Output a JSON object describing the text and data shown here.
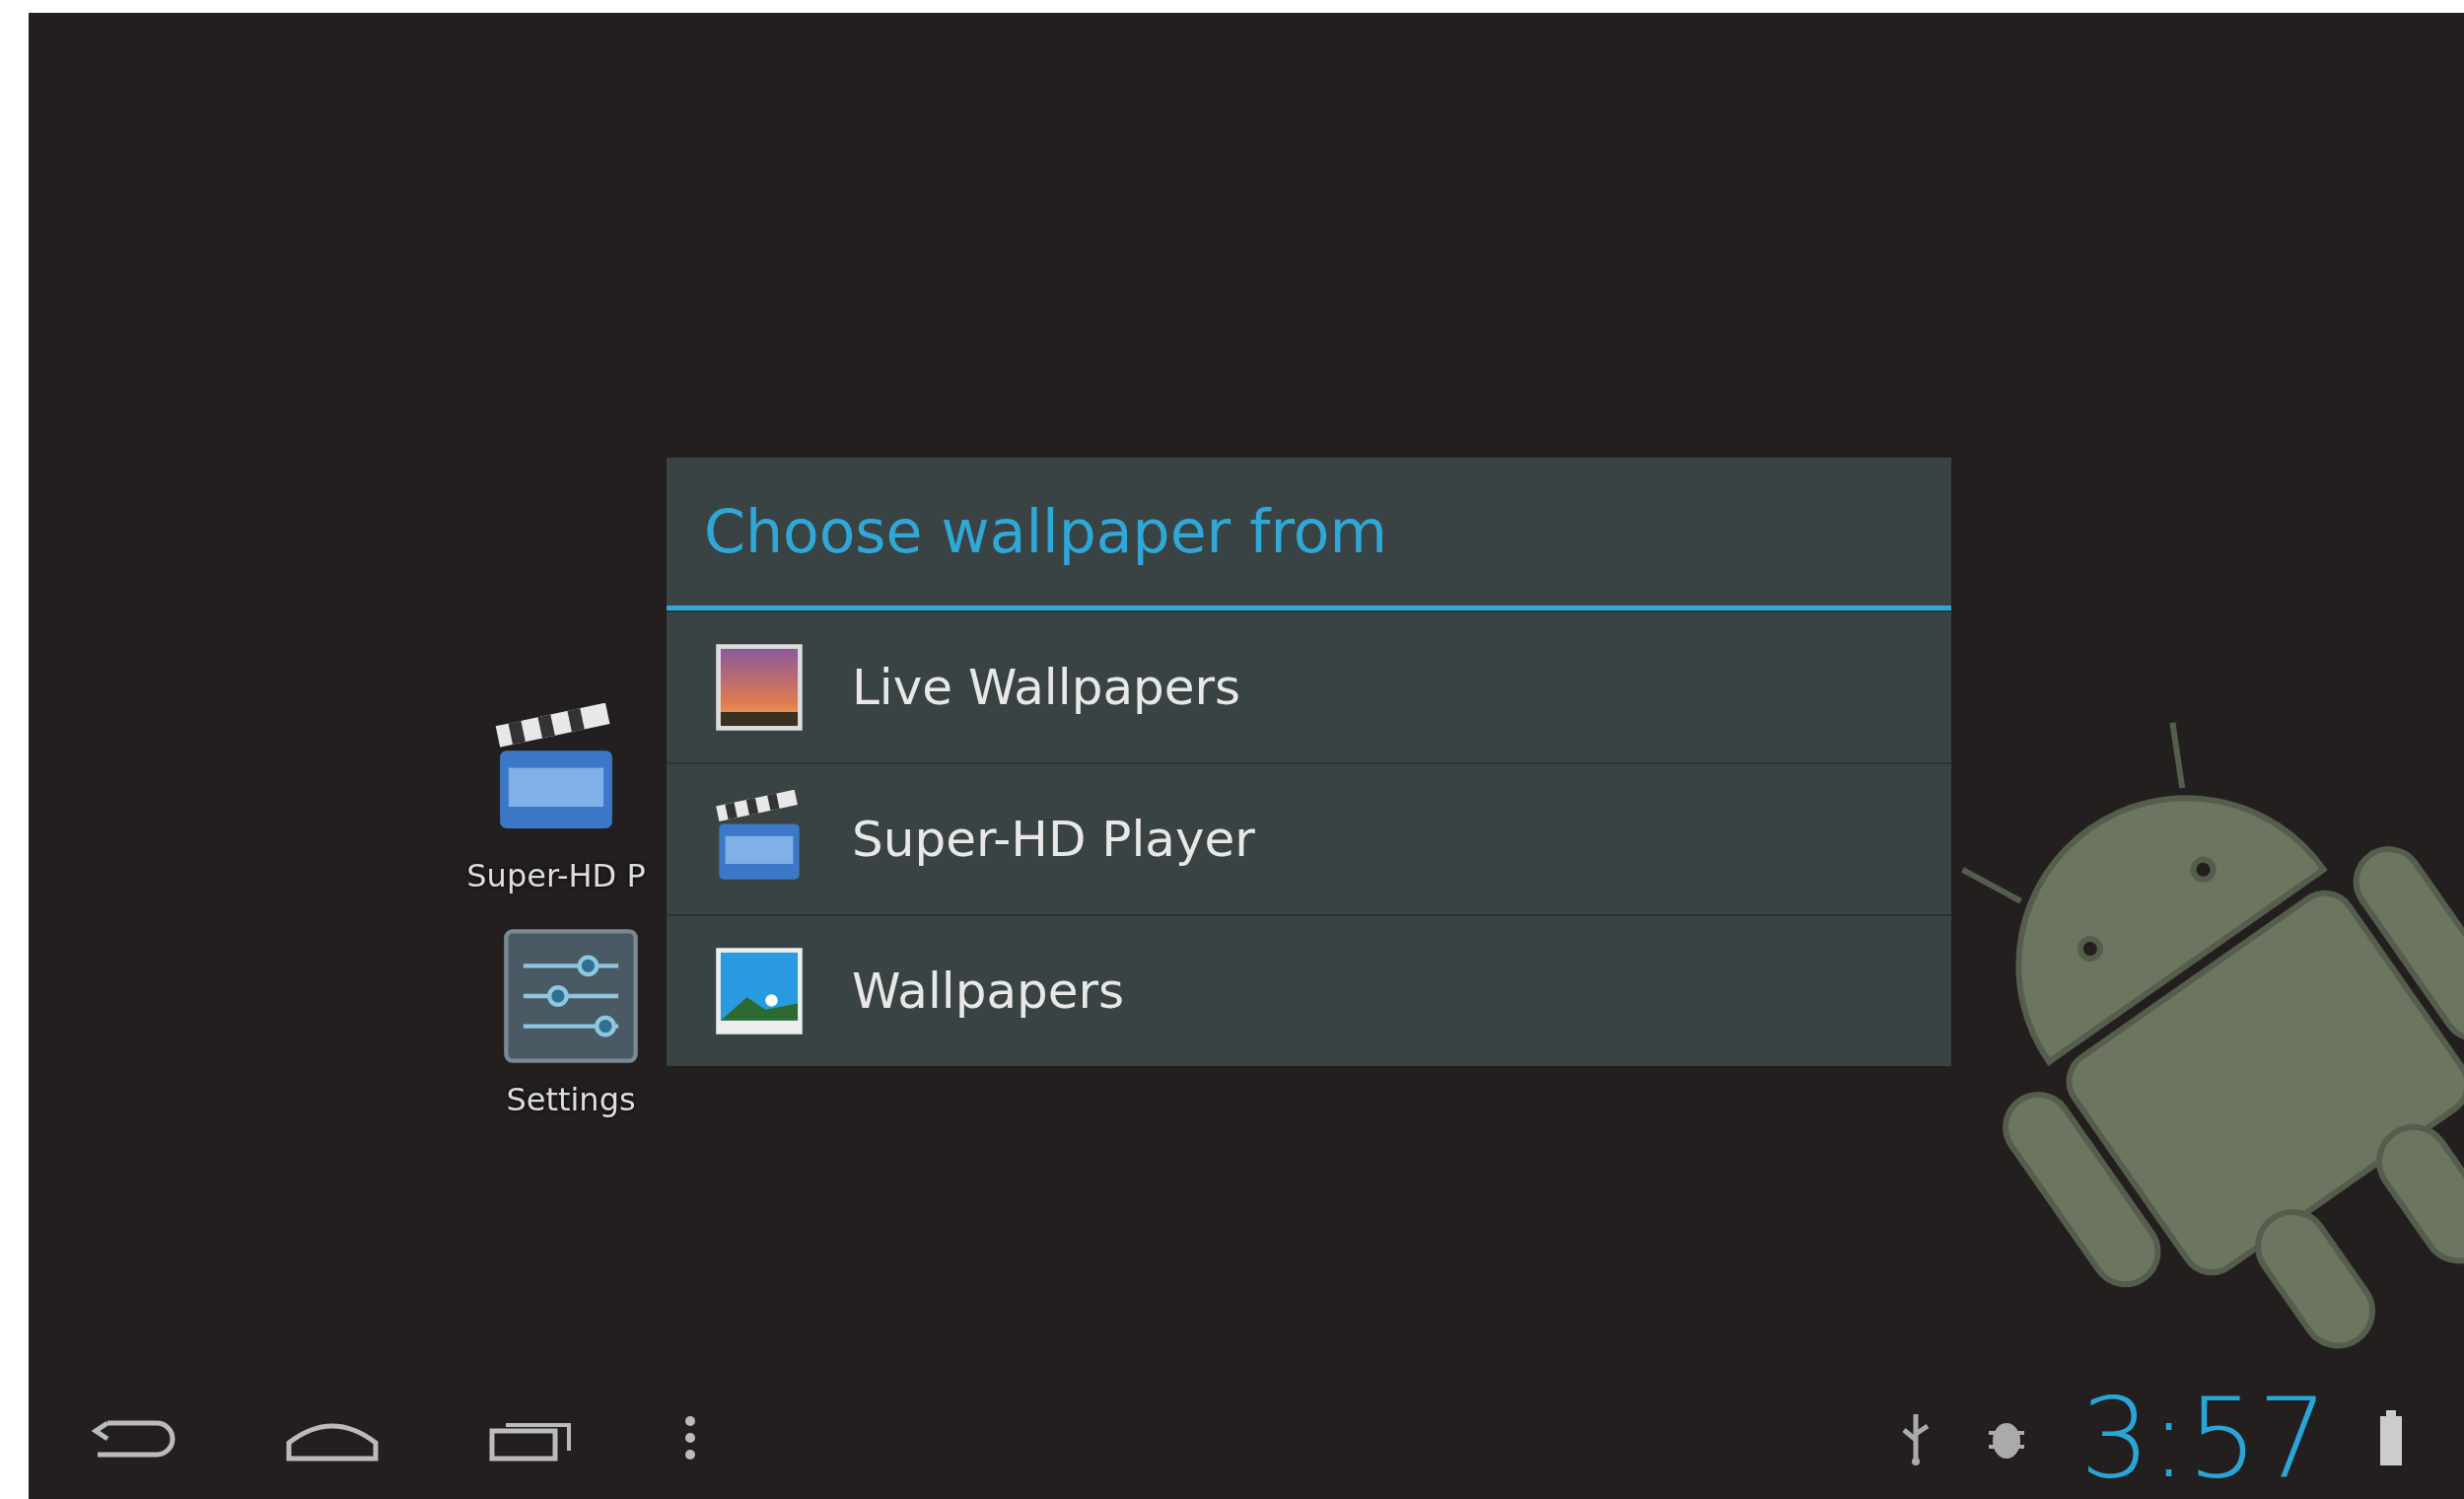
{
  "home_screen": {
    "shortcuts": [
      {
        "kind": "video",
        "label": "Super-HD P"
      },
      {
        "kind": "settings",
        "label": "Settings"
      }
    ]
  },
  "dialog": {
    "title": "Choose wallpaper from",
    "items": [
      {
        "kind": "live",
        "label": "Live Wallpapers"
      },
      {
        "kind": "video",
        "label": "Super-HD Player"
      },
      {
        "kind": "gallery",
        "label": "Wallpapers"
      }
    ]
  },
  "status_bar": {
    "time": "3:57"
  }
}
